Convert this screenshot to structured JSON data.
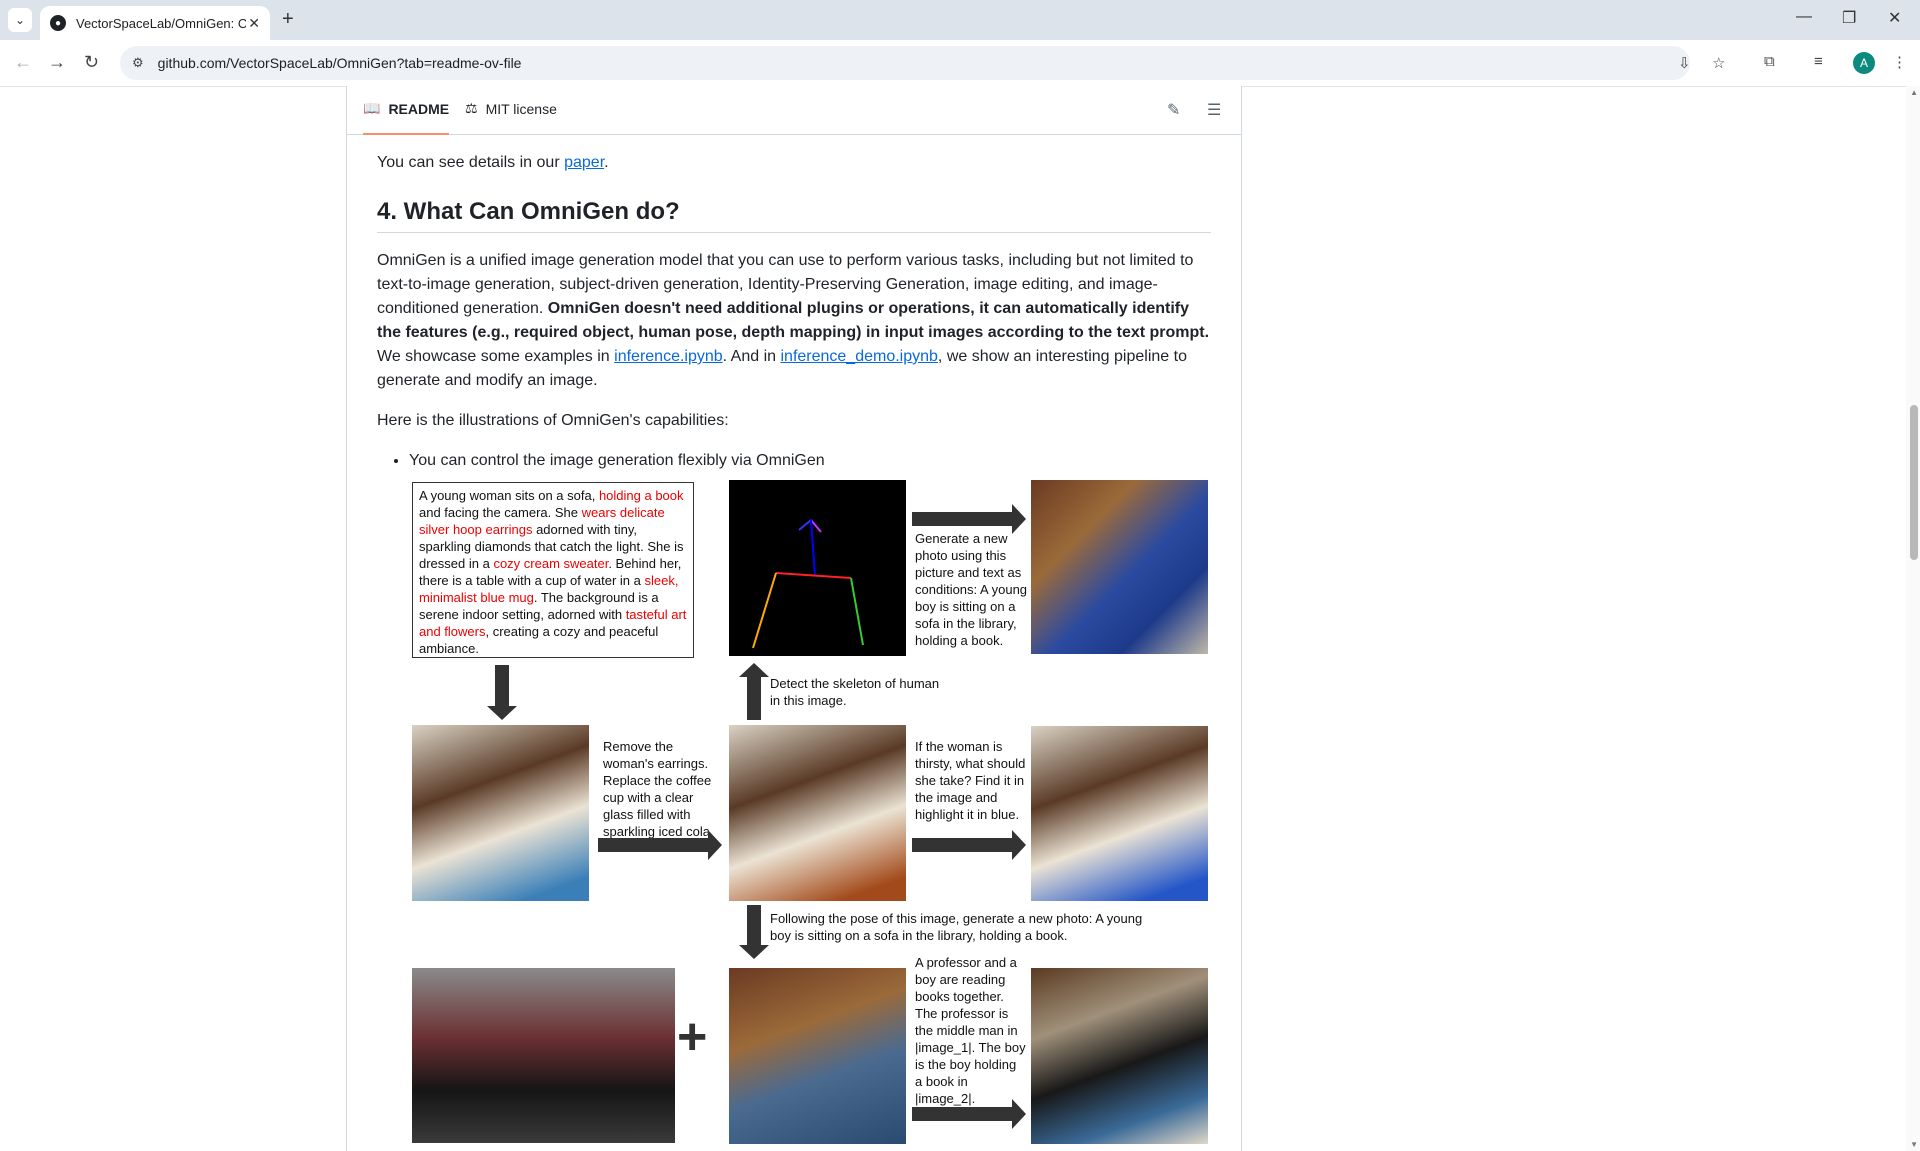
{
  "browser": {
    "tab_title": "VectorSpaceLab/OmniGen: Om",
    "url": "github.com/VectorSpaceLab/OmniGen?tab=readme-ov-file",
    "avatar_letter": "A"
  },
  "readme": {
    "tabs": [
      "README",
      "MIT license"
    ],
    "intro": "You can see details in our ",
    "intro_link": "paper",
    "heading": "4. What Can OmniGen do?",
    "p1_a": "OmniGen is a unified image generation model that you can use to perform various tasks, including but not limited to text-to-image generation, subject-driven generation, Identity-Preserving Generation, image editing, and image-conditioned generation. ",
    "p1_bold": "OmniGen doesn't need additional plugins or operations, it can automatically identify the features (e.g., required object, human pose, depth mapping) in input images according to the text prompt.",
    "p1_b": " We showcase some examples in ",
    "p1_link1": "inference.ipynb",
    "p1_c": ". And in ",
    "p1_link2": "inference_demo.ipynb",
    "p1_d": ", we show an interesting pipeline to generate and modify an image.",
    "p2": "Here is the illustrations of OmniGen's capabilities:",
    "bullet": "You can control the image generation flexibly via OmniGen"
  },
  "figure": {
    "prompt": {
      "t1": "A young woman sits on a sofa, ",
      "r1": "holding a book",
      "t2": " and facing the camera. She ",
      "r2": "wears delicate silver hoop earrings",
      "t3": " adorned with tiny, sparkling diamonds that catch the light. She is dressed in a ",
      "r3": "cozy cream sweater",
      "t4": ". Behind her, there is a table with a cup of water in a ",
      "r4": "sleek, minimalist blue mug",
      "t5": ". The background is a serene indoor setting, adorned with ",
      "r5": "tasteful art and flowers",
      "t6": ", creating a cozy and peaceful ambiance."
    },
    "generate_text": "Generate a new photo using this picture and text as conditions: A young boy is sitting on a sofa in the library, holding a book.",
    "skeleton_text": "Detect the skeleton of human in this image.",
    "remove_text": "Remove the woman's earrings. Replace the coffee cup with a clear glass filled with sparkling iced cola.",
    "thirsty_text": "If the woman is thirsty, what should she take? Find it in the image and highlight it in blue.",
    "pose_text": "Following the pose of this image, generate a new photo: A young boy is sitting on a sofa in the library, holding a book.",
    "professor_text": "A professor and a boy are reading books together. The professor is the middle man in |image_1|. The boy is the boy holding a book in |image_2|.",
    "plus": "+"
  }
}
